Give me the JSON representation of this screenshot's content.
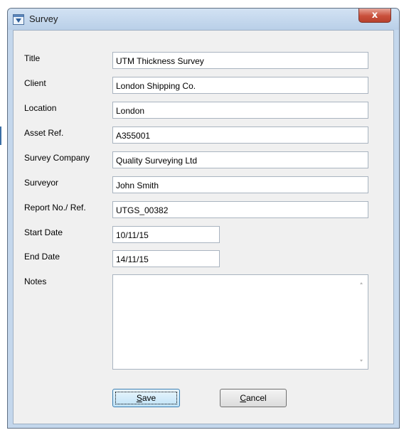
{
  "window": {
    "title": "Survey",
    "close_glyph": "x",
    "icon": "form-window-icon"
  },
  "form": {
    "fields": [
      {
        "label": "Title",
        "value": "UTM Thickness Survey"
      },
      {
        "label": "Client",
        "value": "London Shipping Co."
      },
      {
        "label": "Location",
        "value": "London"
      },
      {
        "label": "Asset Ref.",
        "value": "A355001"
      },
      {
        "label": "Survey Company",
        "value": "Quality Surveying Ltd"
      },
      {
        "label": "Surveyor",
        "value": "John Smith"
      },
      {
        "label": "Report No./ Ref.",
        "value": "UTGS_00382"
      },
      {
        "label": "Start Date",
        "value": "10/11/15"
      },
      {
        "label": "End Date",
        "value": "14/11/15"
      }
    ],
    "notes": {
      "label": "Notes",
      "value": ""
    }
  },
  "buttons": {
    "save_label": "Save",
    "save_mnemonic": "S",
    "save_rest": "ave",
    "cancel_label": "Cancel",
    "cancel_mnemonic": "C",
    "cancel_rest": "ancel"
  },
  "colors": {
    "title_bar": "#c4d7ec",
    "close_button": "#c9503c",
    "client_area": "#f0f0f0",
    "default_button": "#bfe2f7"
  }
}
